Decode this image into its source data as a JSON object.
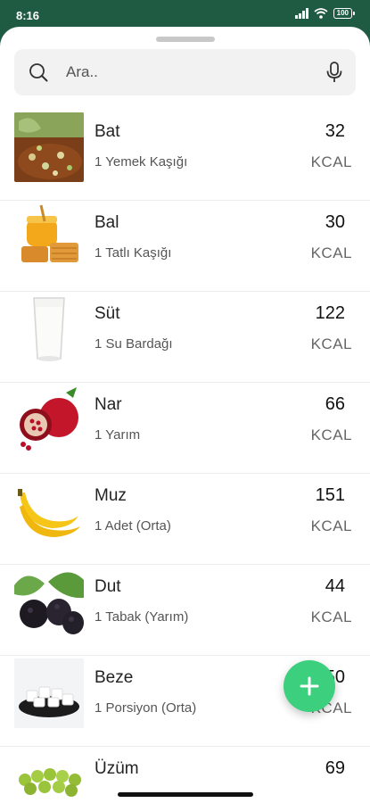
{
  "status_bar": {
    "time": "8:16",
    "battery": "100"
  },
  "search": {
    "placeholder": "Ara.."
  },
  "foods": [
    {
      "name": "Bat",
      "portion": "1 Yemek Kaşığı",
      "kcal": "32",
      "unit": "KCAL"
    },
    {
      "name": "Bal",
      "portion": "1 Tatlı Kaşığı",
      "kcal": "30",
      "unit": "KCAL"
    },
    {
      "name": "Süt",
      "portion": "1 Su Bardağı",
      "kcal": "122",
      "unit": "KCAL"
    },
    {
      "name": "Nar",
      "portion": "1 Yarım",
      "kcal": "66",
      "unit": "KCAL"
    },
    {
      "name": "Muz",
      "portion": "1 Adet (Orta)",
      "kcal": "151",
      "unit": "KCAL"
    },
    {
      "name": "Dut",
      "portion": "1 Tabak (Yarım)",
      "kcal": "44",
      "unit": "KCAL"
    },
    {
      "name": "Beze",
      "portion": "1 Porsiyon (Orta)",
      "kcal": "50",
      "unit": "KCAL"
    },
    {
      "name": "Üzüm",
      "portion": "",
      "kcal": "69",
      "unit": ""
    }
  ],
  "icons": {
    "search": "search-icon",
    "mic": "microphone-icon",
    "fab": "plus-icon"
  },
  "colors": {
    "status_bar_bg": "#1f5a43",
    "fab_bg": "#3ccf7d",
    "search_bg": "#f2f2f2"
  }
}
